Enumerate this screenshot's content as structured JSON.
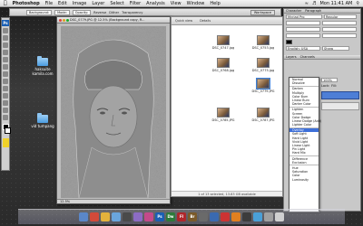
{
  "menubar": {
    "apple": "",
    "app": "Photoshop",
    "items": [
      "File",
      "Edit",
      "Image",
      "Layer",
      "Select",
      "Filter",
      "Analysis",
      "View",
      "Window",
      "Help"
    ],
    "clock": "Mon 11:41 AM"
  },
  "options": {
    "background": "Background:",
    "mode": "Mode:",
    "opacity": "Opacity:",
    "reverse": "Reverse",
    "dither": "Dither",
    "transparency": "Transparency",
    "workspace": "Workspace"
  },
  "tools": {
    "logo": "Ps"
  },
  "desktop": {
    "icon1": "haksuite\nkamila.com",
    "icon2": "vid tumpang"
  },
  "document": {
    "title": "DSC_0779.JPG @ 12.5% (Background copy, R...",
    "status": "12.5%"
  },
  "browser": {
    "tabs": [
      "Quick view",
      "Details"
    ],
    "thumbs": [
      "DSC_0747.jpg",
      "DSC_0753.jpg",
      "DSC_0768.jpg",
      "DSC_0775.jpg",
      "DSC_0779.JPG",
      "DSC_0785.JPG",
      "DSC_0787.JPG"
    ],
    "footer": "1 of 13 selected, 13.83 GB available"
  },
  "panels": {
    "tabs": [
      "Character",
      "Paragraph"
    ],
    "font": "Myriad Pro",
    "style": "Regular",
    "lang": "English: USA",
    "aa": "Sharp",
    "layers_tab": "Layers",
    "channels_tab": "Channels",
    "lock": "Lock:",
    "fill": "Fill:",
    "opacity_val": "100%"
  },
  "blend_modes": [
    [
      "Normal",
      "Dissolve"
    ],
    [
      "Darken",
      "Multiply",
      "Color Burn",
      "Linear Burn",
      "Darker Color"
    ],
    [
      "Lighten",
      "Screen",
      "Color Dodge",
      "Linear Dodge (Add)",
      "Lighter Color"
    ],
    [
      "Overlay",
      "Soft Light",
      "Hard Light",
      "Vivid Light",
      "Linear Light",
      "Pin Light",
      "Hard Mix"
    ],
    [
      "Difference",
      "Exclusion"
    ],
    [
      "Hue",
      "Saturation",
      "Color",
      "Luminosity"
    ]
  ],
  "selected_blend": "Overlay",
  "dock": [
    {
      "label": "",
      "color": "#5a87c9"
    },
    {
      "label": "",
      "color": "#d34a3a"
    },
    {
      "label": "",
      "color": "#e3b23c"
    },
    {
      "label": "",
      "color": "#6aa5dd"
    },
    {
      "label": "",
      "color": "#4a4a4a"
    },
    {
      "label": "",
      "color": "#8c6cc4"
    },
    {
      "label": "",
      "color": "#c44a8a"
    },
    {
      "label": "Ps",
      "color": "#1a5fb4"
    },
    {
      "label": "Dw",
      "color": "#2e7a3a"
    },
    {
      "label": "Fl",
      "color": "#b0262b"
    },
    {
      "label": "Br",
      "color": "#7a5a2a"
    },
    {
      "label": "",
      "color": "#6a6a6a"
    },
    {
      "label": "",
      "color": "#3a6ab0"
    },
    {
      "label": "",
      "color": "#cc3333"
    },
    {
      "label": "",
      "color": "#e08020"
    },
    {
      "label": "",
      "color": "#3c3c3c"
    },
    {
      "label": "",
      "color": "#4aa0d8"
    },
    {
      "label": "",
      "color": "#a0a0a0"
    },
    {
      "label": "",
      "color": "#d0d0d0"
    }
  ]
}
